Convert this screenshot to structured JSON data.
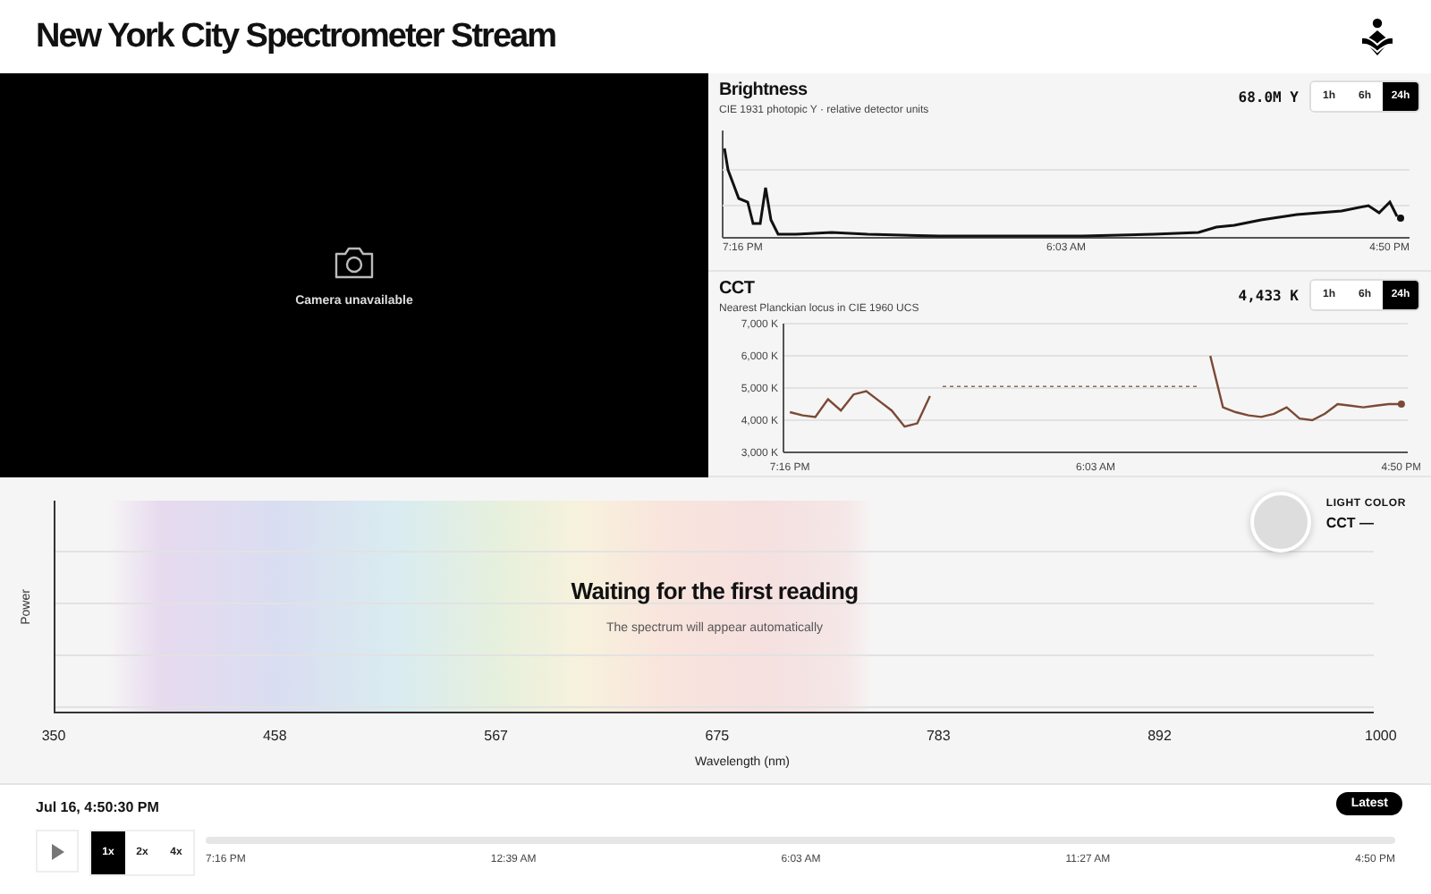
{
  "header": {
    "title": "New York City Spectrometer Stream"
  },
  "camera": {
    "message": "Camera unavailable"
  },
  "brightness": {
    "title": "Brightness",
    "subtitle": "CIE 1931 photopic Y · relative detector units",
    "value": "68.0M Y",
    "ranges": [
      {
        "label": "1h",
        "selected": false
      },
      {
        "label": "6h",
        "selected": false
      },
      {
        "label": "24h",
        "selected": true
      }
    ],
    "x_labels": [
      "7:16 PM",
      "6:03 AM",
      "4:50 PM"
    ]
  },
  "cct": {
    "title": "CCT",
    "subtitle": "Nearest Planckian locus in CIE 1960 UCS",
    "value": "4,433 K",
    "ranges": [
      {
        "label": "1h",
        "selected": false
      },
      {
        "label": "6h",
        "selected": false
      },
      {
        "label": "24h",
        "selected": true
      }
    ],
    "chart_data": {
      "type": "line",
      "grid": true,
      "categories": [
        "7:16 PM",
        null,
        null,
        null,
        null,
        null,
        null,
        null,
        null,
        null,
        null,
        null,
        null,
        null,
        null,
        null,
        null,
        null,
        null,
        null,
        null,
        null,
        null,
        null,
        "6:03 AM",
        null,
        null,
        null,
        null,
        null,
        null,
        null,
        null,
        null,
        null,
        null,
        null,
        null,
        null,
        null,
        null,
        null,
        null,
        null,
        null,
        null,
        null,
        null,
        "4:50 PM"
      ],
      "series": [
        {
          "color": "#7a4a36",
          "values": [
            4250,
            4150,
            4100,
            4650,
            4300,
            4800,
            4900,
            4600,
            4300,
            3800,
            3900,
            4750,
            null,
            null,
            null,
            null,
            null,
            null,
            null,
            null,
            null,
            null,
            null,
            null,
            null,
            null,
            null,
            null,
            null,
            null,
            null,
            null,
            null,
            null,
            null,
            null,
            null,
            null,
            null,
            null,
            null,
            null,
            null,
            null,
            null,
            null,
            null,
            null,
            null
          ]
        },
        {
          "color": "#8a6a5a",
          "line_style": "dashed",
          "values": [
            null,
            null,
            null,
            null,
            null,
            null,
            null,
            null,
            null,
            null,
            null,
            null,
            5050,
            5050,
            5050,
            5050,
            5050,
            5050,
            5050,
            5050,
            5050,
            5050,
            5050,
            5050,
            5050,
            5050,
            5050,
            5050,
            5050,
            5050,
            5050,
            5050,
            5050,
            null,
            null,
            null,
            null,
            null,
            null,
            null,
            null,
            null,
            null,
            null,
            null,
            null,
            null,
            null,
            null
          ]
        },
        {
          "color": "#7a4a36",
          "values": [
            null,
            null,
            null,
            null,
            null,
            null,
            null,
            null,
            null,
            null,
            null,
            null,
            null,
            null,
            null,
            null,
            null,
            null,
            null,
            null,
            null,
            null,
            null,
            null,
            null,
            null,
            null,
            null,
            null,
            null,
            null,
            null,
            null,
            6000,
            4400,
            4250,
            4150,
            4100,
            4200,
            4400,
            4050,
            4000,
            4200,
            4500,
            4450,
            4400,
            4450,
            4500,
            4500
          ]
        }
      ],
      "ylim": [
        3000,
        7000
      ],
      "yticks": [
        {
          "value": 3000,
          "label": "3,000 K"
        },
        {
          "value": 4000,
          "label": "4,000 K"
        },
        {
          "value": 5000,
          "label": "5,000 K"
        },
        {
          "value": 6000,
          "label": "6,000 K"
        },
        {
          "value": 7000,
          "label": "7,000 K"
        }
      ]
    }
  },
  "spectrum": {
    "ylabel": "Power",
    "xlabel": "Wavelength (nm)",
    "x_ticks": [
      "350",
      "458",
      "567",
      "675",
      "783",
      "892",
      "1000"
    ],
    "message": "Waiting for the first reading",
    "hint": "The spectrum will appear automatically",
    "light_color": {
      "label": "LIGHT COLOR",
      "cct": "CCT —"
    }
  },
  "timeline": {
    "timestamp": "Jul 16, 4:50:30 PM",
    "latest": "Latest",
    "speeds": [
      {
        "label": "1x",
        "selected": true
      },
      {
        "label": "2x",
        "selected": false
      },
      {
        "label": "4x",
        "selected": false
      }
    ],
    "ticks": [
      "7:16 PM",
      "12:39 AM",
      "6:03 AM",
      "11:27 AM",
      "4:50 PM"
    ]
  }
}
